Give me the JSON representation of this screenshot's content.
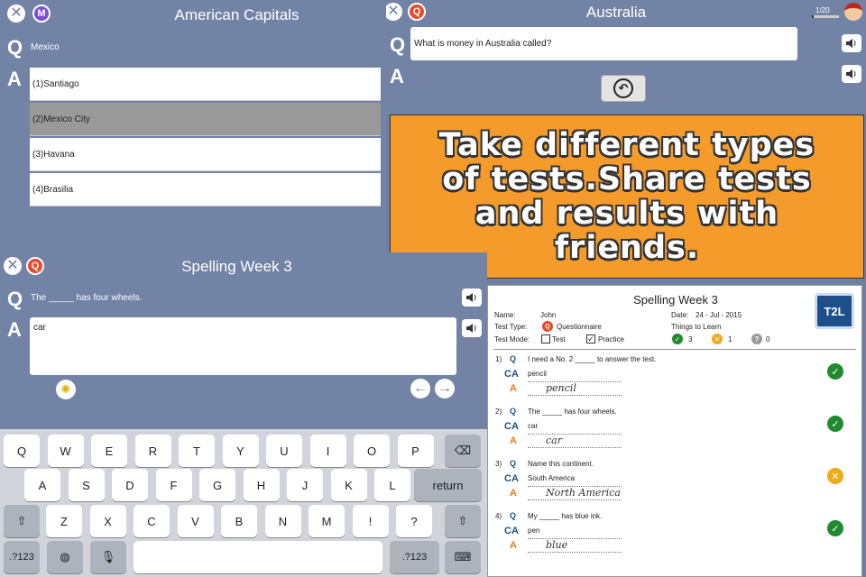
{
  "panel1": {
    "title": "American Capitals",
    "question": "Mexico",
    "q_letter": "Q",
    "a_letter": "A",
    "badge": "M",
    "options": [
      "(1)Santiago",
      "(2)Mexico City",
      "(3)Havana",
      "(4)Brasilia"
    ]
  },
  "panel2": {
    "title": "Australia",
    "progress": "1/20",
    "question": "What is money in Australia called?",
    "q_letter": "Q",
    "a_letter": "A",
    "badge": "Q"
  },
  "promo": {
    "text": "Take different types of tests.Share tests and results with friends."
  },
  "panel3": {
    "title": "Spelling Week 3",
    "question": "The _____ has four wheels.",
    "answer": "car",
    "q_letter": "Q",
    "a_letter": "A",
    "badge": "Q"
  },
  "keyboard": {
    "row1": [
      "Q",
      "W",
      "E",
      "R",
      "T",
      "Y",
      "U",
      "I",
      "O",
      "P"
    ],
    "row2": [
      "A",
      "S",
      "D",
      "F",
      "G",
      "H",
      "J",
      "K",
      "L"
    ],
    "row3": [
      "Z",
      "X",
      "C",
      "V",
      "B",
      "N",
      "M",
      "!",
      "?"
    ],
    "return": "return",
    "numbers": ".?123",
    "backspace_icon": "backspace-icon",
    "shift_icon": "shift-icon"
  },
  "report": {
    "title": "Spelling Week 3",
    "logo": "T2L",
    "name_label": "Name:",
    "name_value": "John",
    "date_label": "Date:",
    "date_value": "24 - Jul - 2015",
    "type_label": "Test Type:",
    "type_value": "Questionnaire",
    "learn_label": "Things to Learn",
    "mode_label": "Test Mode:",
    "mode_test": "Test",
    "mode_practice": "Practice",
    "count_correct": "3",
    "count_wrong": "1",
    "count_unknown": "0",
    "items": [
      {
        "num": "1)",
        "q": "I need a No. 2 _____ to answer the test.",
        "ca": "pencil",
        "a": "pencil",
        "status": "correct"
      },
      {
        "num": "2)",
        "q": "The _____ has four wheels.",
        "ca": "car",
        "a": "car",
        "status": "correct"
      },
      {
        "num": "3)",
        "q": "Name this continent.",
        "ca": "South America",
        "a": "North America",
        "status": "wrong"
      },
      {
        "num": "4)",
        "q": "My _____ has blue ink.",
        "ca": "pen",
        "a": "blue",
        "status": "correct"
      }
    ]
  },
  "colors": {
    "panel_bg": "#7383a6",
    "promo_bg": "#f49b2c",
    "correct": "#1f8a2e",
    "wrong": "#f2a91a"
  }
}
